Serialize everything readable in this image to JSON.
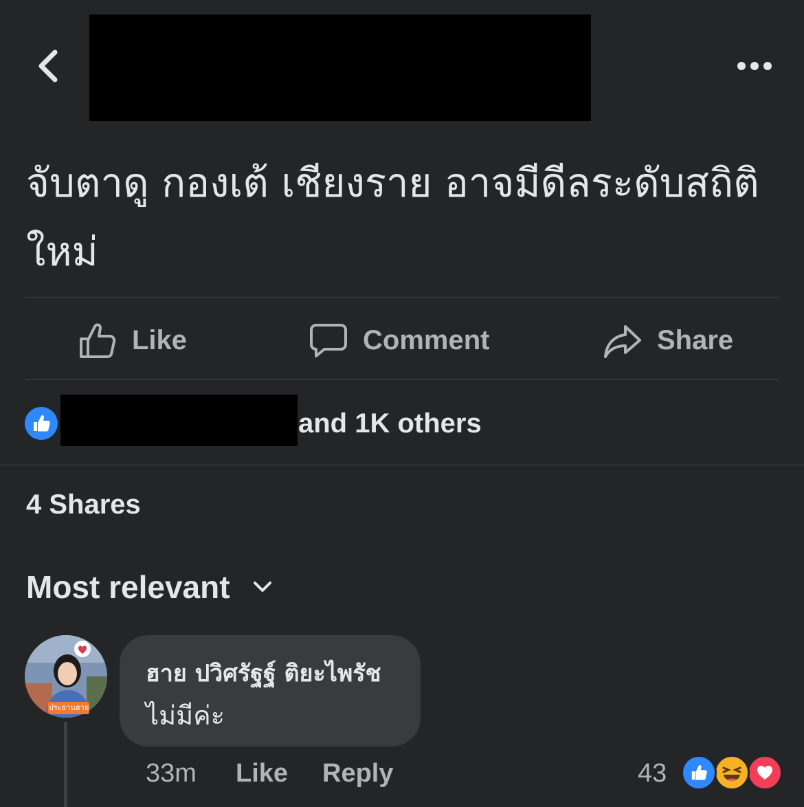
{
  "header": {
    "back_icon": "chevron-left-icon",
    "more_icon": "more-horizontal-icon"
  },
  "post": {
    "text": "จับตาดู กองเต้ เชียงราย อาจมีดีลระดับสถิติ ใหม่"
  },
  "actions": {
    "like_label": "Like",
    "comment_label": "Comment",
    "share_label": "Share"
  },
  "reactions": {
    "summary_suffix": "and 1K others"
  },
  "shares": {
    "label": "4 Shares"
  },
  "sort": {
    "label": "Most relevant"
  },
  "comment": {
    "author": "ฮาย ปวิศรัฐฐ์ ติยะไพรัช",
    "body": "ไม่มีค่ะ",
    "avatar_tag": "ประธานฮาย",
    "time": "33m",
    "like_label": "Like",
    "reply_label": "Reply",
    "reaction_count": "43"
  },
  "colors": {
    "background": "#242526",
    "bubble": "#3a3b3c",
    "like_blue": "#2e89ff",
    "haha_yellow": "#f7b125",
    "love_red": "#f33e58",
    "secondary_text": "#b0b3b8"
  }
}
